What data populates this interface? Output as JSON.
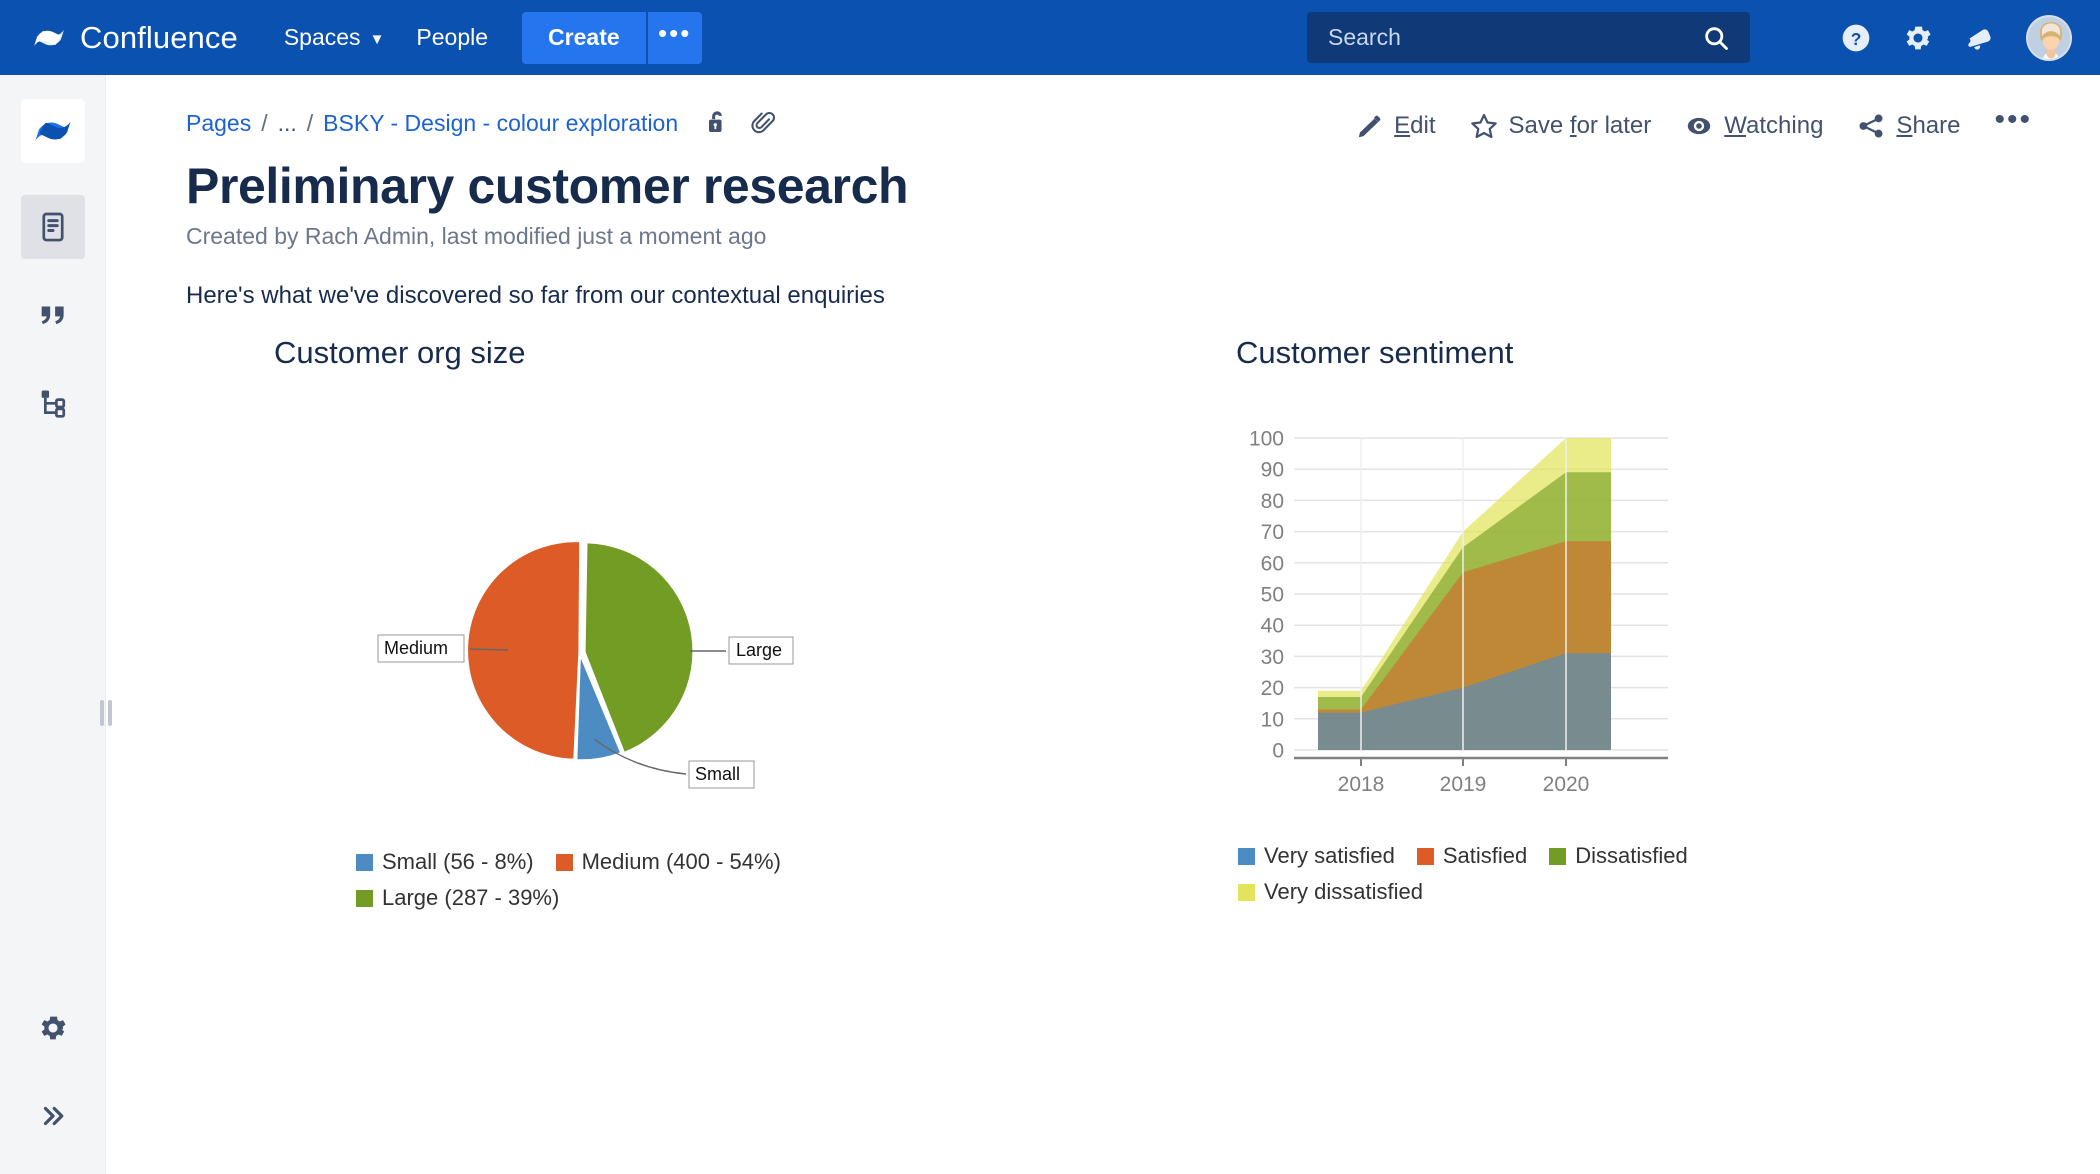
{
  "topnav": {
    "brand": "Confluence",
    "brand_icon": "confluence-logo-icon",
    "spaces_label": "Spaces",
    "people_label": "People",
    "create_label": "Create",
    "create_more_label": "•••",
    "search_placeholder": "Search",
    "search_value": "",
    "icons": [
      "help-icon",
      "settings-icon",
      "notifications-bell-icon",
      "user-avatar"
    ]
  },
  "sidebar": {
    "items": [
      {
        "name": "space-logo",
        "icon": "confluence-space-logo-icon",
        "selected": false
      },
      {
        "name": "pages",
        "icon": "page-document-icon",
        "selected": true
      },
      {
        "name": "blog",
        "icon": "blog-quote-icon",
        "selected": false
      },
      {
        "name": "page-tree",
        "icon": "page-tree-icon",
        "selected": false
      }
    ],
    "bottom_items": [
      {
        "name": "space-settings",
        "icon": "gear-icon"
      },
      {
        "name": "expand-sidebar",
        "icon": "double-chevron-right-icon"
      }
    ]
  },
  "breadcrumb": {
    "pages_label": "Pages",
    "ellipsis_label": "...",
    "space_label": "BSKY - Design - colour exploration",
    "separator": "/",
    "restrictions_icon": "unlocked-padlock-icon",
    "attachments_icon": "paperclip-icon"
  },
  "page_actions": [
    {
      "name": "edit",
      "icon": "pencil-icon",
      "pre": "",
      "key": "E",
      "post": "dit"
    },
    {
      "name": "save-for-later",
      "icon": "star-icon",
      "pre": "Save ",
      "key": "f",
      "post": "or later"
    },
    {
      "name": "watching",
      "icon": "eye-icon",
      "pre": "",
      "key": "W",
      "post": "atching"
    },
    {
      "name": "share",
      "icon": "share-icon",
      "pre": "",
      "key": "S",
      "post": "hare"
    }
  ],
  "page_actions_more": "•••",
  "page": {
    "title": "Preliminary customer research",
    "meta": "Created by Rach Admin, last modified just a moment ago",
    "intro": "Here's what we've discovered so far from our contextual enquiries"
  },
  "colors": {
    "blue": "#4C8CC3",
    "orange": "#DD5B26",
    "green": "#729C23",
    "yellow": "#E2E55C",
    "nav_blue": "#0B51B0",
    "create_blue": "#2575EF",
    "link_blue": "#1C62D3",
    "text_dark": "#172B4D"
  },
  "chart_data": [
    {
      "type": "pie",
      "title": "Customer org size",
      "labels": [
        "Small",
        "Medium",
        "Large"
      ],
      "values": [
        56,
        400,
        287
      ],
      "percents": [
        8,
        54,
        39
      ],
      "colors": [
        "#4C8CC3",
        "#DD5B26",
        "#729C23"
      ],
      "point_labels": [
        "Medium",
        "Large",
        "Small"
      ],
      "legend": [
        "Small (56 - 8%)",
        "Medium (400 - 54%)",
        "Large (287 - 39%)"
      ],
      "legend_position": "bottom",
      "exploded": true
    },
    {
      "type": "area",
      "title": "Customer sentiment",
      "stacked": true,
      "x": [
        "2018",
        "2019",
        "2020"
      ],
      "xtick_labels": [
        "2018",
        "2019",
        "2020"
      ],
      "ytick_labels": [
        "0",
        "10",
        "20",
        "30",
        "40",
        "50",
        "60",
        "70",
        "80",
        "90",
        "100"
      ],
      "ylim": [
        0,
        100
      ],
      "grid": true,
      "series": [
        {
          "name": "Very satisfied",
          "color": "#4C8CC3",
          "values": [
            12,
            20,
            31
          ]
        },
        {
          "name": "Satisfied",
          "color": "#DD5B26",
          "values": [
            1,
            37,
            36
          ]
        },
        {
          "name": "Dissatisfied",
          "color": "#729C23",
          "values": [
            4,
            8,
            22
          ]
        },
        {
          "name": "Very dissatisfied",
          "color": "#E2E55C",
          "values": [
            2,
            5,
            11
          ]
        }
      ],
      "legend": [
        "Very satisfied",
        "Satisfied",
        "Dissatisfied",
        "Very dissatisfied"
      ],
      "legend_position": "bottom"
    }
  ]
}
